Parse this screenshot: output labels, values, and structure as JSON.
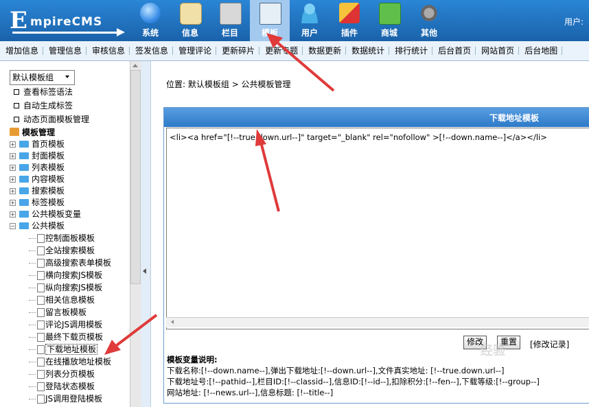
{
  "header": {
    "logo_text": "EmpireCMS",
    "logo_initial": "E",
    "logo_rest": "mpireCMS",
    "nav": [
      {
        "label": "系统",
        "icon": "globe-icon"
      },
      {
        "label": "信息",
        "icon": "notepad-icon"
      },
      {
        "label": "栏目",
        "icon": "folder-icon"
      },
      {
        "label": "模板",
        "icon": "window-icon",
        "active": true
      },
      {
        "label": "用户",
        "icon": "user-icon"
      },
      {
        "label": "插件",
        "icon": "tools-icon"
      },
      {
        "label": "商城",
        "icon": "card-icon"
      },
      {
        "label": "其他",
        "icon": "gear-icon"
      }
    ],
    "user_label": "用户:"
  },
  "subnav": [
    "增加信息",
    "管理信息",
    "审核信息",
    "签发信息",
    "管理评论",
    "更新碎片",
    "更新专题",
    "数据更新",
    "数据统计",
    "排行统计",
    "后台首页",
    "网站首页",
    "后台地图"
  ],
  "sidebar": {
    "group_select": "默认模板组",
    "top_links": [
      "查看标签语法",
      "自动生成标签",
      "动态页面模板管理"
    ],
    "tree_root": "模板管理",
    "folders": [
      "首页模板",
      "封面模板",
      "列表模板",
      "内容模板",
      "搜索模板",
      "标签模板",
      "公共模板变量",
      "公共模板"
    ],
    "leaves": [
      "控制面板模板",
      "全站搜索模板",
      "高级搜索表单模板",
      "横向搜索JS模板",
      "纵向搜索JS模板",
      "相关信息模板",
      "留言板模板",
      "评论JS调用模板",
      "最终下载页模板",
      "下载地址模板",
      "在线播放地址模板",
      "列表分页模板",
      "登陆状态模板",
      "JS调用登陆模板"
    ],
    "selected_leaf": "下载地址模板"
  },
  "main": {
    "location_prefix": "位置:",
    "location_path": "默认模板组 > 公共模板管理",
    "panel_title": "下载地址模板",
    "code": "<li><a href=\"[!--true.down.url--]\"  target=\"_blank\" rel=\"nofollow\" >[!--down.name--]</a></li>",
    "edit_button": "修改",
    "reset_button": "重置",
    "history_link": "[修改记录]",
    "vars_title": "模板变量说明:",
    "vars_lines": [
      "下载名称:[!--down.name--],弹出下载地址:[!--down.url--],文件真实地址: [!--true.down.url--]",
      "下载地址号:[!--pathid--],栏目ID:[!--classid--],信息ID:[!--id--],扣除积分:[!--fen--],下载等级:[!--group--]",
      "网站地址: [!--news.url--],信息标题: [!--title--]"
    ]
  },
  "watermark": "经验",
  "colors": {
    "header_blue": "#2277c4",
    "active_tab": "#a3c9ef",
    "panel_header": "#2c7fcf",
    "annotation_red": "#e03a3a"
  }
}
